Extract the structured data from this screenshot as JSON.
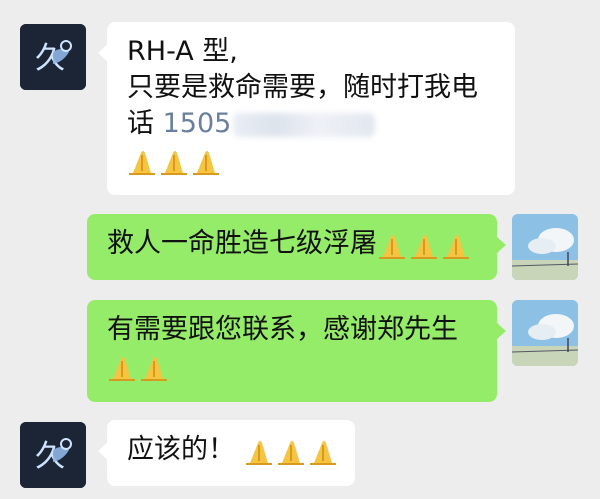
{
  "messages": [
    {
      "side": "left",
      "lines": [
        "RH-A 型,",
        "只要是救命需要，随时打我电"
      ],
      "phone_prefix": "话 ",
      "phone_visible": "1505",
      "emoji": "pray-hands-icon",
      "emoji_count": 3
    },
    {
      "side": "right",
      "lines": [
        "救人一命胜造七级浮屠"
      ],
      "emoji": "pray-hands-icon",
      "emoji_count": 3
    },
    {
      "side": "right",
      "lines": [
        "有需要跟您联系，感谢郑先生"
      ],
      "emoji": "pray-hands-icon",
      "emoji_count": 2
    },
    {
      "side": "left",
      "lines": [
        "应该的！"
      ],
      "emoji": "pray-hands-icon",
      "emoji_count": 3
    }
  ],
  "avatars": {
    "left_logo_text": "久",
    "right": "sky-landscape-avatar"
  },
  "colors": {
    "background": "#ededed",
    "incoming_bubble": "#ffffff",
    "outgoing_bubble": "#95ec69",
    "phone_text": "#6a7f9d"
  }
}
